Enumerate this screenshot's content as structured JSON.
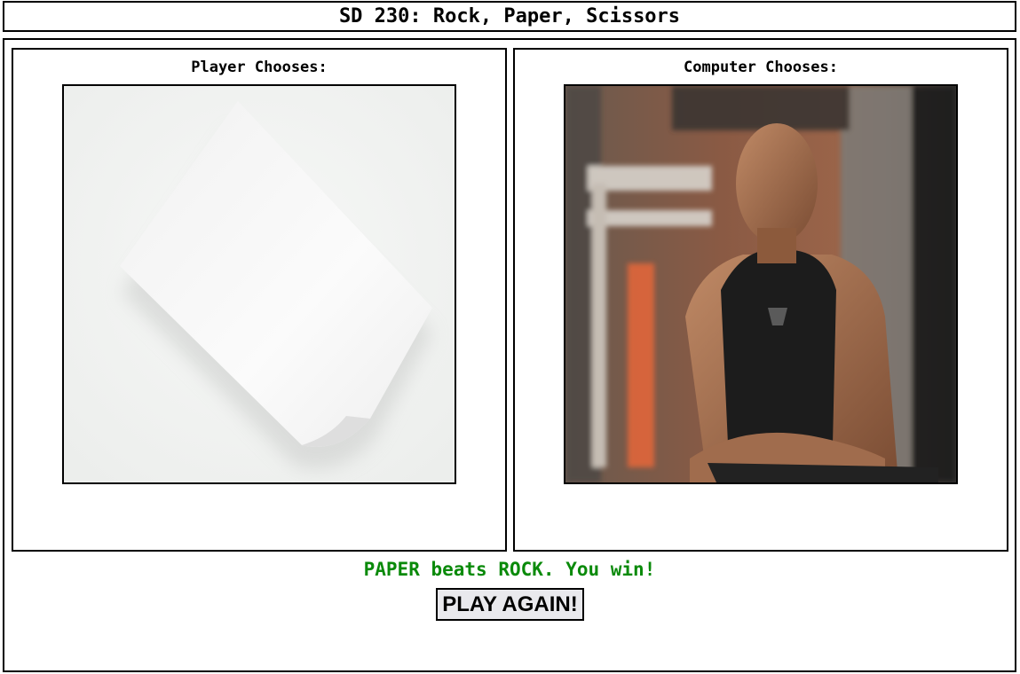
{
  "header": {
    "title": "SD 230: Rock, Paper, Scissors"
  },
  "player": {
    "label": "Player Chooses:",
    "choice": "PAPER",
    "image_icon": "paper-sheet-image"
  },
  "computer": {
    "label": "Computer Chooses:",
    "choice": "ROCK",
    "image_icon": "rock-photo-image"
  },
  "result": {
    "message": "PAPER beats ROCK. You win!",
    "color": "#0a8a0a"
  },
  "actions": {
    "play_again_label": "PLAY AGAIN!"
  }
}
